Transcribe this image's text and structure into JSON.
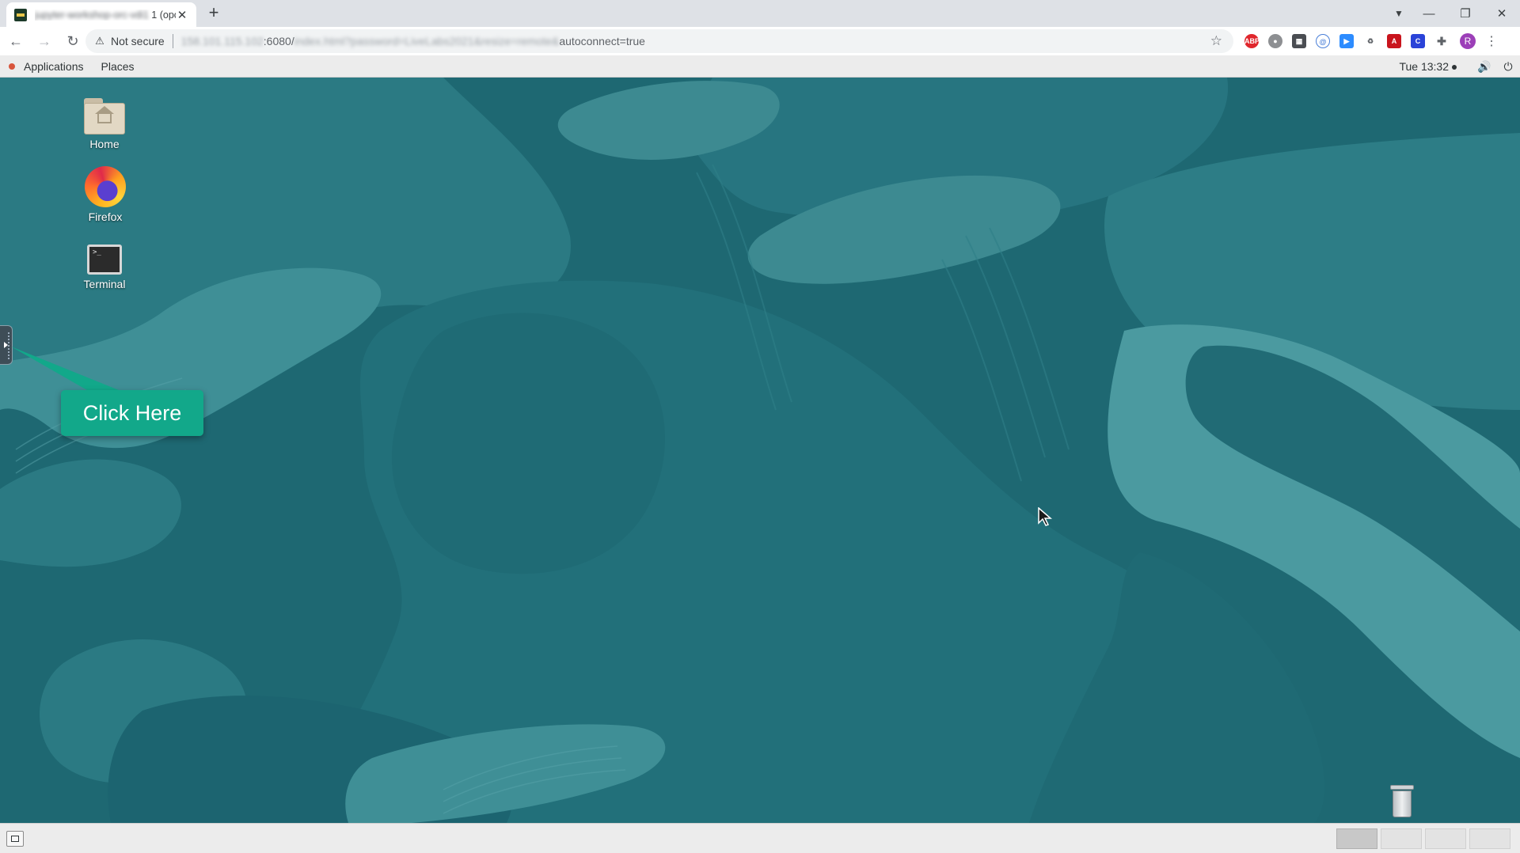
{
  "browser": {
    "tab": {
      "title_blurred": "jupyter-workshop-orc-vdi1",
      "title_suffix": "1 (opc)",
      "favicon": "vnc-icon"
    },
    "omnibox": {
      "security_label": "Not secure",
      "url_host": "158.101.115.102",
      "url_port": ":6080/",
      "url_path": "index.html?password=LiveLabs2021&resize=remote&",
      "url_tail": "autoconnect=true"
    },
    "extensions": [
      "abp-icon",
      "ghost-icon",
      "grid-icon",
      "at-icon",
      "zoom-icon",
      "recycle-icon",
      "pdf-icon",
      "c-icon",
      "puzzle-icon"
    ],
    "profile_initial": "R"
  },
  "gnome": {
    "menus": [
      "Applications",
      "Places"
    ],
    "clock": "Tue 13:32",
    "tray": [
      "volume-icon",
      "power-icon"
    ]
  },
  "desktop": {
    "icons": [
      {
        "label": "Home",
        "icon": "home-folder-icon"
      },
      {
        "label": "Firefox",
        "icon": "firefox-icon"
      },
      {
        "label": "Terminal",
        "icon": "terminal-icon"
      }
    ],
    "callout_label": "Click Here",
    "workspace_count": 4,
    "active_workspace": 1,
    "colors": {
      "wallpaper_base": "#1e6872",
      "callout": "#12a88a"
    }
  }
}
